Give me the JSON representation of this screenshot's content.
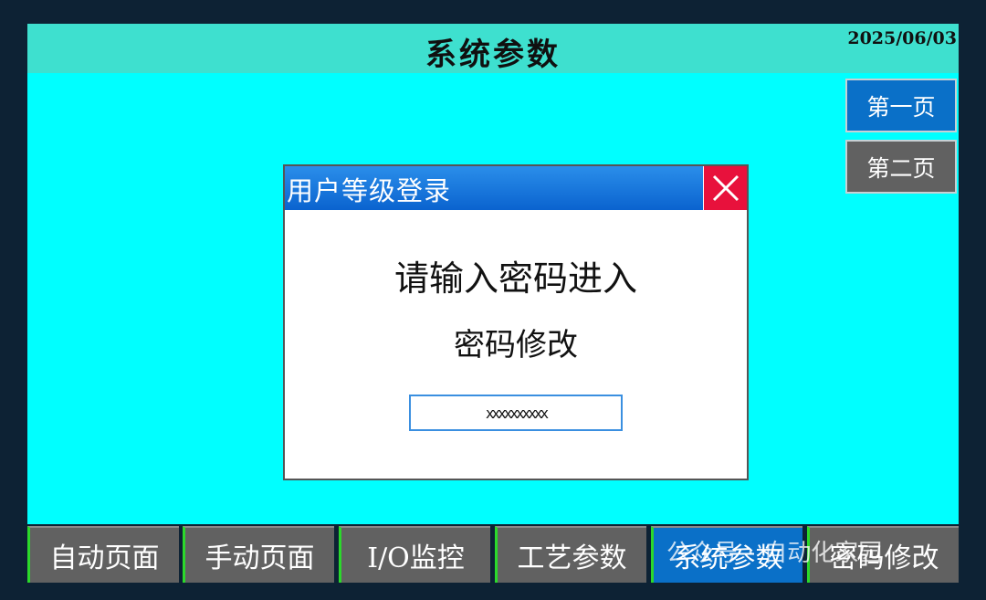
{
  "header": {
    "title": "系统参数",
    "date": "2025/06/03"
  },
  "pages": [
    {
      "label": "第一页"
    },
    {
      "label": "第二页"
    }
  ],
  "dialog": {
    "title": "用户等级登录",
    "prompt": "请输入密码进入",
    "change_password": "密码修改",
    "password_value": "xxxxxxxxxx"
  },
  "nav": [
    {
      "label": "自动页面"
    },
    {
      "label": "手动页面"
    },
    {
      "label": "I/O监控"
    },
    {
      "label": "工艺参数"
    },
    {
      "label": "系统参数"
    },
    {
      "label": "密码修改"
    }
  ],
  "watermark": {
    "prefix": "公众号",
    "name": "自动化家园"
  },
  "colors": {
    "screen_bg": "#00ffff",
    "title_bar": "#3ee0cf",
    "active_blue": "#0a70c8",
    "button_gray": "#616161",
    "close_red": "#e8113c",
    "nav_accent_green": "#2bd92b"
  }
}
